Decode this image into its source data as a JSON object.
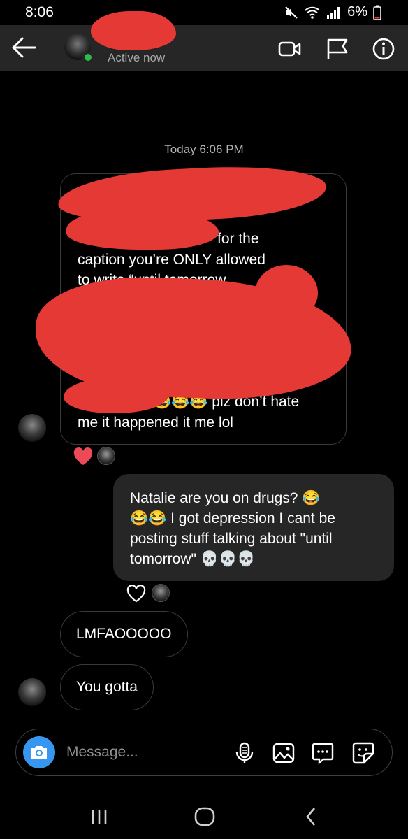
{
  "status_bar": {
    "time": "8:06",
    "battery": "6%"
  },
  "header": {
    "active_status": "Active now"
  },
  "thread": {
    "timestamp": "Today 6:06 PM"
  },
  "messages": {
    "incoming_1": {
      "line1": "for the",
      "line2": "caption you’re ONLY allowed",
      "line3": "to write “until tomorrow",
      "line4": "😂😂😂 plz don’t hate",
      "line5": "me it happened it me lol"
    },
    "outgoing_1": {
      "line1": "Natalie are you on drugs? 😂",
      "line2": "😂😂 I got depression I cant be",
      "line3": "posting stuff talking about \"until",
      "line4": "tomorrow\" 💀💀💀"
    },
    "incoming_2": {
      "text": "LMFAOOOOO"
    },
    "incoming_3": {
      "text": "You gotta"
    }
  },
  "composer": {
    "placeholder": "Message..."
  },
  "colors": {
    "accent": "#3797f0",
    "redaction": "#e53935",
    "reaction": "#ed4956",
    "online": "#2dbb4a"
  },
  "icons": [
    "back-arrow-icon",
    "video-call-icon",
    "flag-icon",
    "info-icon",
    "camera-icon",
    "microphone-icon",
    "gallery-icon",
    "chat-bubble-icon",
    "sticker-icon",
    "heart-icon"
  ]
}
